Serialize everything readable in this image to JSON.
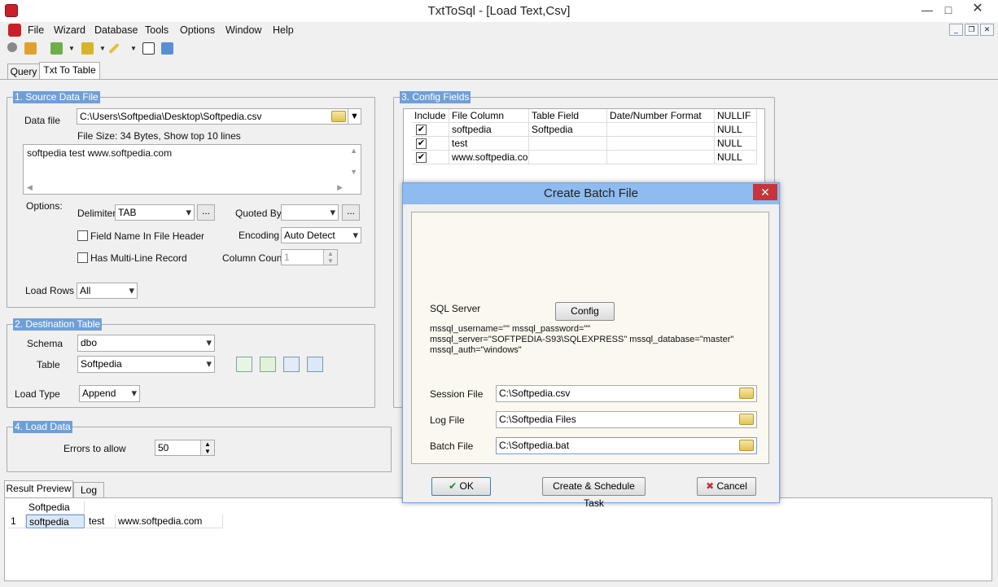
{
  "window": {
    "title": "TxtToSql - [Load Text,Csv]",
    "minimize_glyph": "—",
    "maximize_glyph": "□",
    "close_glyph": "✕"
  },
  "menu": [
    "File",
    "Wizard",
    "Database",
    "Tools",
    "Options",
    "Window",
    "Help"
  ],
  "mdi_controls": [
    "_",
    "❐",
    "✕"
  ],
  "tabs": {
    "query": "Query",
    "txt_to_table": "Txt To Table"
  },
  "source": {
    "legend": "1. Source Data File",
    "data_file_label": "Data file",
    "data_file_value": "C:\\Users\\Softpedia\\Desktop\\Softpedia.csv",
    "file_info": "File Size: 34 Bytes,  Show top 10 lines",
    "preview_text": "softpedia  test         www.softpedia.com",
    "options_label": "Options:",
    "delimiter_label": "Delimiter",
    "delimiter_value": "TAB",
    "quoted_by_label": "Quoted By",
    "quoted_by_value": "",
    "field_name_header_label": "Field Name In File Header",
    "encoding_label": "Encoding",
    "encoding_value": "Auto Detect",
    "multi_line_label": "Has Multi-Line Record",
    "column_count_label": "Column Count",
    "column_count_value": "1",
    "load_rows_label": "Load Rows",
    "load_rows_value": "All",
    "ellipsis": "..."
  },
  "destination": {
    "legend": "2. Destination Table",
    "schema_label": "Schema",
    "schema_value": "dbo",
    "table_label": "Table",
    "table_value": "Softpedia",
    "load_type_label": "Load Type",
    "load_type_value": "Append"
  },
  "load_data": {
    "legend": "4. Load Data",
    "errors_label": "Errors to allow",
    "errors_value": "50"
  },
  "config_fields": {
    "legend": "3. Config Fields",
    "columns": [
      "Include",
      "File Column",
      "Table Field",
      "Date/Number Format",
      "NULLIF"
    ],
    "rows": [
      {
        "include": "✔",
        "file_column": "softpedia",
        "table_field": "Softpedia",
        "format": "",
        "nullif": "NULL"
      },
      {
        "include": "✔",
        "file_column": "test",
        "table_field": "",
        "format": "",
        "nullif": "NULL"
      },
      {
        "include": "✔",
        "file_column": "www.softpedia.com",
        "table_field": "",
        "format": "",
        "nullif": "NULL"
      }
    ]
  },
  "result_tabs": {
    "preview": "Result Preview",
    "log": "Log"
  },
  "result_grid": {
    "header": "Softpedia",
    "row_number": "1",
    "cells": [
      "softpedia",
      "test",
      "www.softpedia.com"
    ]
  },
  "dialog": {
    "title": "Create Batch File",
    "close_glyph": "✕",
    "sql_server_label": "SQL Server",
    "config_button": "Config",
    "connection_line1": " mssql_username=\"\" mssql_password=\"\"",
    "connection_line2": "mssql_server=\"SOFTPEDIA-S93\\SQLEXPRESS\" mssql_database=\"master\"",
    "connection_line3": "mssql_auth=\"windows\"",
    "session_file_label": "Session File",
    "session_file_value": "C:\\Softpedia.csv",
    "log_file_label": "Log File",
    "log_file_value": "C:\\Softpedia Files",
    "batch_file_label": "Batch File",
    "batch_file_value": "C:\\Softpedia.bat",
    "ok_button": "OK",
    "ok_glyph": "✔",
    "schedule_button": "Create & Schedule Task",
    "cancel_button": "Cancel",
    "cancel_glyph": "✖"
  },
  "colors": {
    "legend": "#6f9fd8",
    "dialog_title": "#8ebbf0",
    "close_red": "#c7343b"
  }
}
